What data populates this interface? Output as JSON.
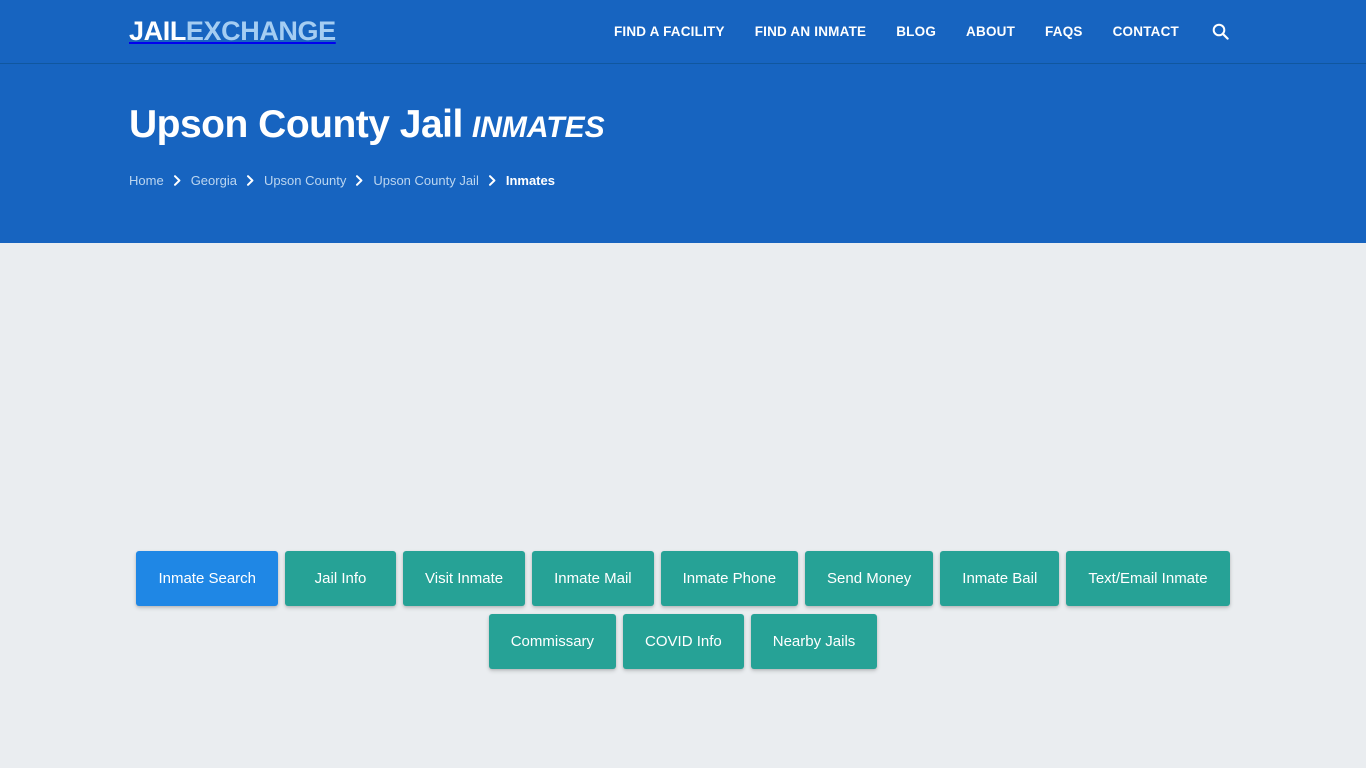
{
  "brand": {
    "logo_primary": "JAIL",
    "logo_secondary": "EXCHANGE"
  },
  "nav": {
    "items": [
      {
        "label": "FIND A FACILITY"
      },
      {
        "label": "FIND AN INMATE"
      },
      {
        "label": "BLOG"
      },
      {
        "label": "ABOUT"
      },
      {
        "label": "FAQs"
      },
      {
        "label": "CONTACT"
      }
    ],
    "search_icon": "search-icon"
  },
  "hero": {
    "title": "Upson County Jail",
    "title_suffix": "INMATES",
    "breadcrumb": [
      {
        "label": "Home",
        "current": false
      },
      {
        "label": "Georgia",
        "current": false
      },
      {
        "label": "Upson County",
        "current": false
      },
      {
        "label": "Upson County Jail",
        "current": false
      },
      {
        "label": "Inmates",
        "current": true
      }
    ],
    "separator_icon": "chevron-right-icon"
  },
  "main": {
    "facility_nav_buttons": [
      {
        "label": "Inmate Search",
        "active": true
      },
      {
        "label": "Jail Info",
        "active": false
      },
      {
        "label": "Visit Inmate",
        "active": false
      },
      {
        "label": "Inmate Mail",
        "active": false
      },
      {
        "label": "Inmate Phone",
        "active": false
      },
      {
        "label": "Send Money",
        "active": false
      },
      {
        "label": "Inmate Bail",
        "active": false
      },
      {
        "label": "Text/Email Inmate",
        "active": false
      },
      {
        "label": "Commissary",
        "active": false
      },
      {
        "label": "COVID Info",
        "active": false
      },
      {
        "label": "Nearby Jails",
        "active": false
      }
    ]
  },
  "colors": {
    "header_blue": "#1764c0",
    "accent_blue": "#1f87e5",
    "teal": "#26a296",
    "page_background": "#eaedf0",
    "logo_secondary": "#a5cdf2",
    "breadcrumb_link": "#bcd6f0"
  }
}
